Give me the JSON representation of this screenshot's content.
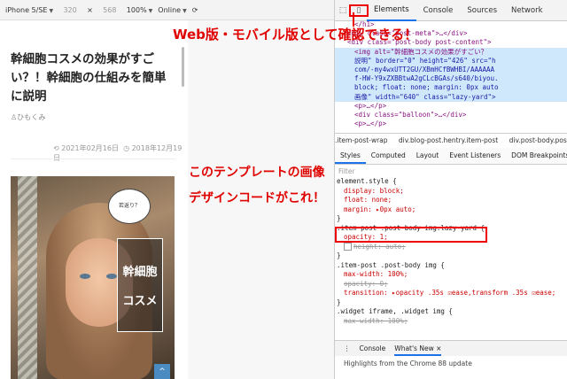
{
  "device_toolbar": {
    "device": "iPhone 5/SE",
    "width": "320",
    "times": "×",
    "height": "568",
    "zoom": "100%",
    "network": "Online"
  },
  "page": {
    "title": "幹細胞コスメの効果がすごい？！幹細胞の仕組みを簡単に説明",
    "author": "ひもくみ",
    "updated": "2021年02月16日",
    "published": "2018年12月19日",
    "image_bubble": "若返り？",
    "image_sign_line1": "幹細胞",
    "image_sign_line2": "コスメ",
    "to_top": "^"
  },
  "devtools": {
    "tabs": [
      "Elements",
      "Console",
      "Sources",
      "Network"
    ],
    "dom_lines": [
      "</h1>",
      "<div class=\"post-meta\">…</div>",
      "<div class=\"post-body post-content\">",
      "<img alt=\"幹細胞コスメの効果がすごい？",
      "説明\" border=\"0\" height=\"426\" src=\"h",
      "com/-my4wxUTT2GU/XBmHCfBWHBI/AAAAAA",
      "f-HW-Y9xZXBBtwA2gCLcBGAs/s640/biyou.",
      "block; float: none; margin: 0px auto",
      "画像\" width=\"640\" class=\"lazy-yard\">",
      "<p>…</p>",
      "<div class=\"balloon\">…</div>",
      "<p>…</p>"
    ],
    "breadcrumbs": [
      ".item-post-wrap",
      "div.blog-post.hentry.item-post",
      "div.post-body.post-"
    ],
    "style_tabs": [
      "Styles",
      "Computed",
      "Layout",
      "Event Listeners",
      "DOM Breakpoints"
    ],
    "filter_placeholder": "Filter",
    "rules": {
      "element_style": "element.style {",
      "es_display": "display: block;",
      "es_float": "float: none;",
      "es_margin": "margin: ▸0px auto;",
      "close": "}",
      "rule1_selector": ".item-post .post-body img.lazy-yard {",
      "rule1_opacity": "opacity: 1;",
      "rule1_height": "height: auto;",
      "rule2_selector": ".item-post .post-body img {",
      "rule2_maxwidth": "max-width: 100%;",
      "rule2_opacity": "opacity: 0;",
      "rule2_transition": "transition: ▸opacity .35s ☑ease,transform .35s ☑ease;",
      "rule3_selector": ".widget iframe, .widget img {",
      "rule3_maxwidth": "max-width: 100%;"
    },
    "drawer_tabs": [
      "Console",
      "What's New ×"
    ],
    "drawer_text": "Highlights from the Chrome 88 update"
  },
  "annotations": {
    "top": "Web版・モバイル版として確認できる！",
    "middle_line1": "このテンプレートの画像",
    "middle_line2": "デザインコードがこれ！"
  }
}
